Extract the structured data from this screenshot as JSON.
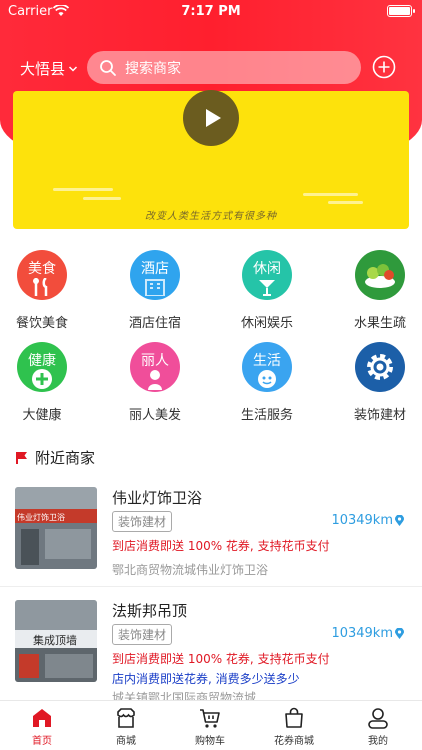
{
  "status_bar": {
    "carrier": "Carrier",
    "time": "7:17 PM"
  },
  "header": {
    "location": "大悟县",
    "search_placeholder": "搜索商家"
  },
  "banner": {
    "caption": "改变人类生活方式有很多种"
  },
  "categories": [
    {
      "label": "餐饮美食",
      "badge": "美食",
      "color": "#f24d3c"
    },
    {
      "label": "酒店住宿",
      "badge": "酒店",
      "color": "#2fa4ee"
    },
    {
      "label": "休闲娱乐",
      "badge": "休闲",
      "color": "#25c4a8"
    },
    {
      "label": "水果生疏",
      "badge": "",
      "color": "#2f9a3c"
    },
    {
      "label": "大健康",
      "badge": "健康",
      "color": "#2fc24e"
    },
    {
      "label": "丽人美发",
      "badge": "丽人",
      "color": "#f04e9a"
    },
    {
      "label": "生活服务",
      "badge": "生活",
      "color": "#3aa4f0"
    },
    {
      "label": "装饰建材",
      "badge": "",
      "color": "#1c5fa8"
    }
  ],
  "nearby": {
    "title": "附近商家",
    "merchants": [
      {
        "name": "伟业灯饰卫浴",
        "tag": "装饰建材",
        "distance": "10349km",
        "promo_red": "到店消费即送 100% 花券, 支持花币支付",
        "address": "鄂北商贸物流城伟业灯饰卫浴",
        "sign_text": "伟业灯饰卫浴"
      },
      {
        "name": "法斯邦吊顶",
        "tag": "装饰建材",
        "distance": "10349km",
        "promo_red": "到店消费即送 100% 花券, 支持花币支付",
        "promo_blue": "店内消费即送花券, 消费多少送多少",
        "address": "城关镇鄂北国际商贸物流城",
        "sign_text": "集成顶墙"
      }
    ]
  },
  "tabbar": {
    "items": [
      {
        "label": "首页",
        "icon": "home-icon"
      },
      {
        "label": "商城",
        "icon": "shop-icon"
      },
      {
        "label": "购物车",
        "icon": "cart-icon"
      },
      {
        "label": "花券商城",
        "icon": "bag-icon"
      },
      {
        "label": "我的",
        "icon": "profile-icon"
      }
    ],
    "active_color": "#e01824"
  }
}
